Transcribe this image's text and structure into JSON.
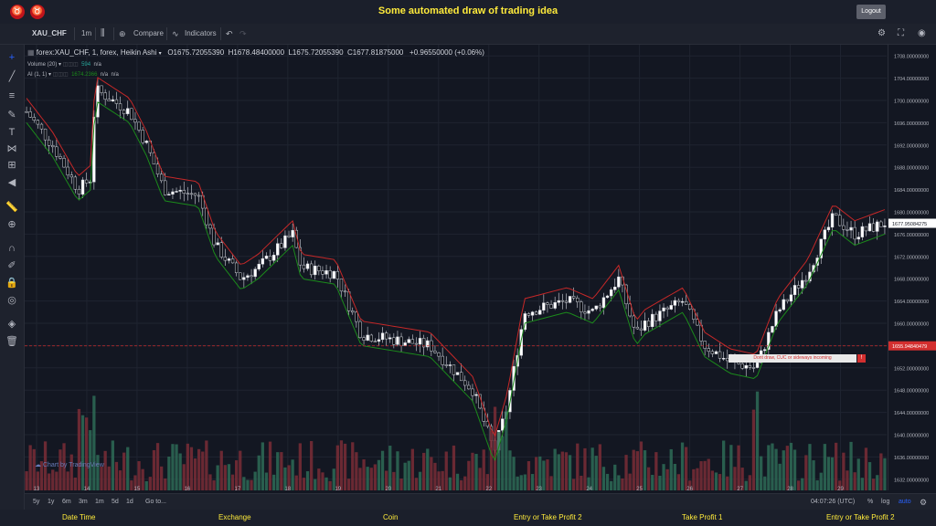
{
  "header": {
    "title": "Some automated draw of trading idea",
    "logout_label": "Logout"
  },
  "toolbar": {
    "symbol": "XAU_CHF",
    "interval": "1m",
    "compare_label": "Compare",
    "indicators_label": "Indicators"
  },
  "legend": {
    "main": "forex:XAU_CHF, 1, forex, Heikin Ashi",
    "open": "O1675.72055390",
    "high": "H1678.48400000",
    "low": "L1675.72055390",
    "close": "C1677.81875000",
    "change": "+0.96550000 (+0.06%)",
    "volume_label": "Volume (20)",
    "volume_value": "594",
    "volume_na": "n/a",
    "ai_label": "AI (1, 1)",
    "ai_value": "1674.2366",
    "ai_na1": "n/a",
    "ai_na2": "n/a"
  },
  "price_axis": {
    "ticks": [
      "1708.00000000",
      "1704.00000000",
      "1700.00000000",
      "1696.00000000",
      "1692.00000000",
      "1688.00000000",
      "1684.00000000",
      "1680.00000000",
      "1676.00000000",
      "1672.00000000",
      "1668.00000000",
      "1664.00000000",
      "1660.00000000",
      "1656.00000000",
      "1652.00000000",
      "1648.00000000",
      "1644.00000000",
      "1640.00000000",
      "1636.00000000",
      "1632.00000000"
    ],
    "current_label": "1677.95084275",
    "marker_label": "1655.94840479",
    "current_color": "#ffffff",
    "marker_color": "#d32f2f"
  },
  "time_axis": {
    "labels": [
      "13",
      "14",
      "15",
      "16",
      "17",
      "18",
      "19",
      "20",
      "21",
      "22",
      "23",
      "24",
      "25",
      "26",
      "27",
      "28",
      "29"
    ]
  },
  "annotation": {
    "text": "Dont draw, CUC or sideways incoming",
    "flag": "!"
  },
  "watermark": {
    "text": "Chart by TradingView"
  },
  "bottom_bar": {
    "ranges": [
      "5y",
      "1y",
      "6m",
      "3m",
      "1m",
      "5d",
      "1d"
    ],
    "goto_label": "Go to...",
    "time": "04:07:26 (UTC)",
    "percent_label": "%",
    "log_label": "log",
    "auto_label": "auto"
  },
  "footer": {
    "items": [
      "Date Time",
      "Exchange",
      "Coin",
      "Entry or Take Profit 2",
      "Take Profit 1",
      "Entry or Take Profit 2"
    ]
  },
  "colors": {
    "accent_yellow": "#ffeb3b",
    "bull": "#ffffff",
    "bear": "#0b0e14",
    "wick": "#d1d4dc",
    "stop_red": "#c62828",
    "ai_green": "#1b8a1b",
    "vol_up": "#2e6b56",
    "vol_down": "#7a2d36"
  }
}
